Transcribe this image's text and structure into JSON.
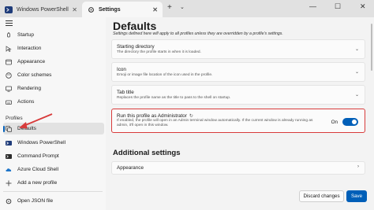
{
  "tabs": {
    "powershell_label": "Windows PowerShell",
    "settings_label": "Settings",
    "close_glyph": "✕",
    "new_tab_glyph": "+",
    "dropdown_glyph": "⌄"
  },
  "window_controls": {
    "minimize": "—",
    "maximize": "☐",
    "close": "✕"
  },
  "sidebar": {
    "items": [
      {
        "label": "Startup"
      },
      {
        "label": "Interaction"
      },
      {
        "label": "Appearance"
      },
      {
        "label": "Color schemes"
      },
      {
        "label": "Rendering"
      },
      {
        "label": "Actions"
      }
    ],
    "profiles_heading": "Profiles",
    "profiles": [
      {
        "label": "Defaults"
      },
      {
        "label": "Windows PowerShell"
      },
      {
        "label": "Command Prompt"
      },
      {
        "label": "Azure Cloud Shell"
      },
      {
        "label": "Add a new profile"
      }
    ],
    "open_json": "Open JSON file"
  },
  "main": {
    "title": "Defaults",
    "description": "Settings defined here will apply to all profiles unless they are overridden by a profile's settings.",
    "cards": [
      {
        "title": "Starting directory",
        "desc": "The directory the profile starts in when it is loaded."
      },
      {
        "title": "Icon",
        "desc": "Emoji or image file location of the icon used in the profile."
      },
      {
        "title": "Tab title",
        "desc": "Replaces the profile name as the title to pass to the shell on startup."
      }
    ],
    "admin": {
      "title": "Run this profile as Administrator",
      "desc": "If enabled, the profile will open in an Admin terminal window automatically. If the current window is already running as admin, it'll open in this window.",
      "toggle_label": "On",
      "toggle_on": true
    },
    "additional_title": "Additional settings",
    "appearance_label": "Appearance",
    "discard_label": "Discard changes",
    "save_label": "Save"
  },
  "colors": {
    "accent": "#005fb8",
    "highlight": "#d83b3b"
  }
}
